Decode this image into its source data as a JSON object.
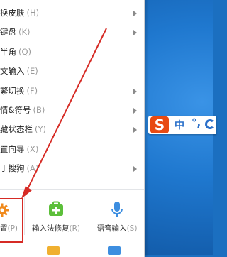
{
  "menu": {
    "items": [
      {
        "label": "换皮肤",
        "key": "(H)",
        "submenu": true
      },
      {
        "label": "键盘",
        "key": "(K)",
        "submenu": true
      },
      {
        "label": "半角",
        "key": "(Q)",
        "submenu": false
      },
      {
        "label": "文输入",
        "key": "(E)",
        "submenu": false
      },
      {
        "label": "繁切换",
        "key": "(F)",
        "submenu": true
      },
      {
        "label": "情&符号",
        "key": "(B)",
        "submenu": true
      },
      {
        "label": "藏状态栏",
        "key": "(Y)",
        "submenu": true
      },
      {
        "label": "置向导",
        "key": "(X)",
        "submenu": false
      },
      {
        "label": "于搜狗",
        "key": "(A)",
        "submenu": true
      }
    ],
    "tiles": [
      {
        "label": "置",
        "key": "(P)",
        "icon": "gear-icon",
        "color": "#f08a1c"
      },
      {
        "label": "输入法修复",
        "key": "(R)",
        "icon": "toolbox-plus-icon",
        "color": "#5cbf3a"
      },
      {
        "label": "语音输入",
        "key": "(S)",
        "icon": "microphone-icon",
        "color": "#3d8ee0"
      }
    ]
  },
  "ime_bar": {
    "logo": "S",
    "lang": "中",
    "punct": "°,",
    "more_icon": "smiley-icon"
  },
  "annotation": {
    "color": "#d62b25"
  }
}
